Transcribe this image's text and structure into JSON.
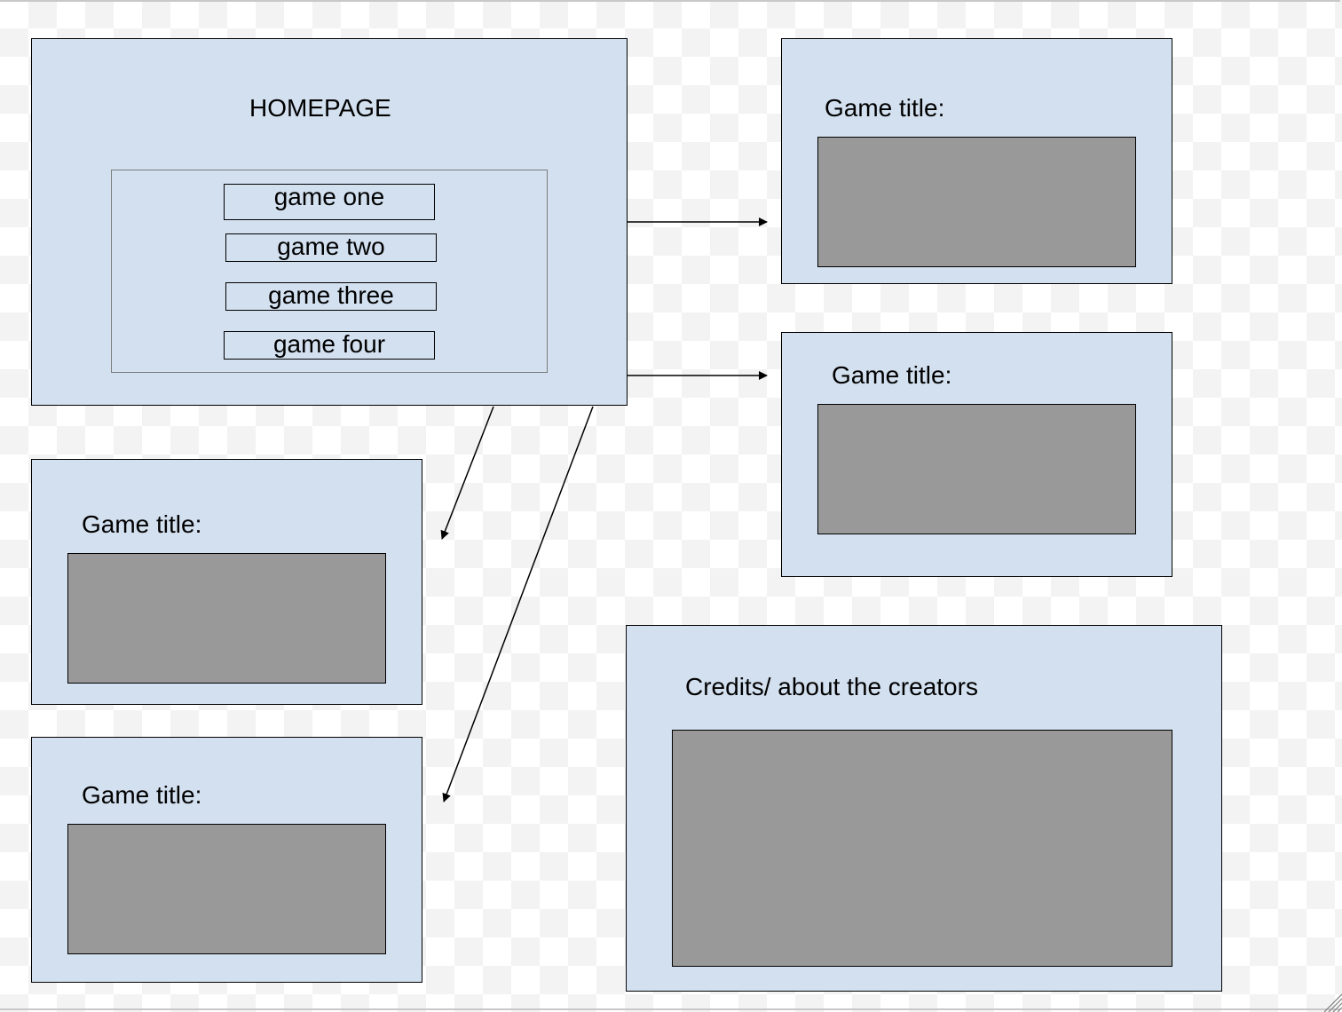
{
  "homepage": {
    "title": "HOMEPAGE",
    "games": [
      "game one",
      "game two",
      "game three",
      "game four"
    ]
  },
  "game_pages": [
    {
      "title": "Game title:"
    },
    {
      "title": "Game title:"
    },
    {
      "title": "Game title:"
    },
    {
      "title": "Game title:"
    }
  ],
  "credits": {
    "title": "Credits/ about the creators"
  },
  "colors": {
    "panel_fill": "#d3e0ef",
    "screen_fill": "#999999",
    "outline": "#000000"
  },
  "icons": {
    "resize_grip": "resize-grip-icon"
  }
}
